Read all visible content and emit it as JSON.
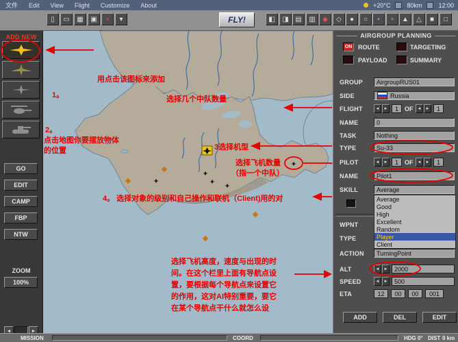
{
  "menubar": {
    "items": [
      "文件",
      "Edit",
      "View",
      "Flight",
      "Customize",
      "About"
    ],
    "temp": "+20°C",
    "visibility": "80km",
    "time": "12:00"
  },
  "toolbar": {
    "fly": "FLY!",
    "left_icons": [
      {
        "name": "new-mission",
        "glyph": "▯"
      },
      {
        "name": "open-mission",
        "glyph": "▭"
      },
      {
        "name": "save-mission",
        "glyph": "▦"
      },
      {
        "name": "options",
        "glyph": "▣"
      },
      {
        "name": "close-mission",
        "glyph": "×"
      },
      {
        "name": "tools",
        "glyph": "▾"
      }
    ],
    "right_icons": [
      "◧",
      "◨",
      "▤",
      "▥",
      "◆",
      "◇",
      "●",
      "○",
      "▪",
      "▫",
      "▲",
      "△",
      "■",
      "□"
    ]
  },
  "ui": {
    "prev": "◄",
    "next": "►"
  },
  "sidebar": {
    "add_new": "ADD NEW",
    "buttons": [
      "GO",
      "EDIT",
      "CAMP",
      "FBP",
      "NTW"
    ],
    "zoom_label": "ZOOM",
    "zoom_value": "100%"
  },
  "panel": {
    "title": "AIRGROUP PLANNING",
    "route_state": "ON",
    "toggles": {
      "route": "ROUTE",
      "targeting": "TARGETING",
      "payload": "PAYLOAD",
      "summary": "SUMMARY"
    },
    "group": {
      "label": "GROUP",
      "value": "AirgroupRUS01"
    },
    "side": {
      "label": "SIDE",
      "value": "Russia"
    },
    "flight": {
      "label": "FLIGHT",
      "value": "1",
      "of": "OF",
      "total": "1"
    },
    "name": {
      "label": "NAME",
      "value": "0"
    },
    "task": {
      "label": "TASK",
      "value": "Nothing"
    },
    "type": {
      "label": "TYPE",
      "value": "Su-33"
    },
    "pilot": {
      "label": "PILOT",
      "value": "1",
      "of": "OF",
      "total": "1"
    },
    "pilot_name": {
      "label": "NAME",
      "value": "Pilot1"
    },
    "skill": {
      "label": "SKILL",
      "value": "Average"
    },
    "skill_options": [
      "Average",
      "Good",
      "High",
      "Excellent",
      "Random",
      "Player",
      "Client"
    ],
    "skill_selected": "Player",
    "wpnt": {
      "label": "WPNT"
    },
    "wp_type": {
      "label": "TYPE"
    },
    "action": {
      "label": "ACTION",
      "value": "TurningPoint"
    },
    "alt": {
      "label": "ALT",
      "value": "2000"
    },
    "speed": {
      "label": "SPEED",
      "value": "500"
    },
    "eta": {
      "label": "ETA",
      "values": [
        "12",
        "00",
        "00",
        "001"
      ]
    },
    "buttons": [
      "ADD",
      "DEL",
      "EDIT"
    ]
  },
  "statusbar": {
    "mission": "MISSION",
    "coord": "COORD",
    "hdg_label": "HDG",
    "hdg_value": "0°",
    "dist_label": "DIST",
    "dist_value": "0 km"
  },
  "annotations": {
    "a1": "用点击该图标来添加",
    "n1": "1。",
    "n2": "2。",
    "a2l1": "点击地图你要摆放物体",
    "a2l2": "的位置",
    "a3": "选择几个中队数量",
    "a4": "3选择机型",
    "a5l1": "选择飞机数量",
    "a5l2": "（指一个中队）",
    "a6": "4。 选择对象的级别和自己操作和联机（Client)用的对",
    "a7l1": "选择飞机高度，速度与出现的时",
    "a7l2": "间。在这个栏里上面有导航点设",
    "a7l3": "置，要根据每个导航点来设置它",
    "a7l4": "的作用，这对AI特别重要，要它",
    "a7l5": "在某个导航点干什么就怎么设"
  },
  "colors": {
    "annotation": "#e60000",
    "skill_selected_bg": "#3a56a8",
    "skill_selected_text": "#ffd400",
    "route_on": "#cc1f1f"
  }
}
